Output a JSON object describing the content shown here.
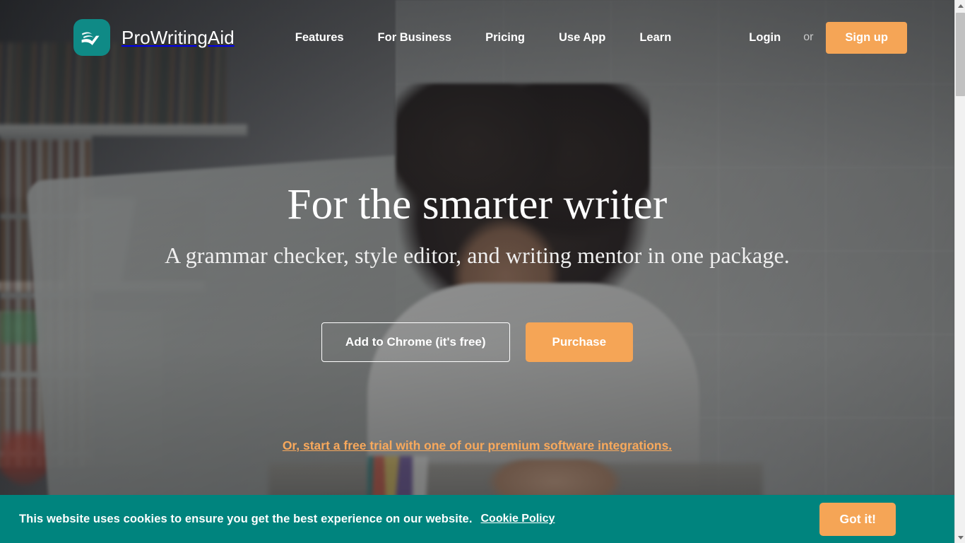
{
  "brand": {
    "name": "ProWritingAid",
    "logo_icon": "book-check-icon",
    "logo_color": "#0f8a86"
  },
  "nav": {
    "items": [
      {
        "label": "Features"
      },
      {
        "label": "For Business"
      },
      {
        "label": "Pricing"
      },
      {
        "label": "Use App"
      },
      {
        "label": "Learn"
      }
    ],
    "login_label": "Login",
    "or_label": "or",
    "signup_label": "Sign up"
  },
  "hero": {
    "title": "For the smarter writer",
    "subtitle": "A grammar checker, style editor, and writing mentor in one package.",
    "primary_cta": "Add to Chrome (it's free)",
    "secondary_cta": "Purchase",
    "trial_text": "Or, start a free trial with one of our premium software integrations."
  },
  "cookie": {
    "message": "This website uses cookies to ensure you get the best experience on our website.",
    "policy_link": "Cookie Policy",
    "accept_label": "Got it!",
    "background_color": "#00847e"
  },
  "widgets": {
    "chat_label": ""
  },
  "colors": {
    "accent_orange": "#f5a556",
    "teal": "#00847e",
    "logo_teal": "#0f8a86"
  }
}
